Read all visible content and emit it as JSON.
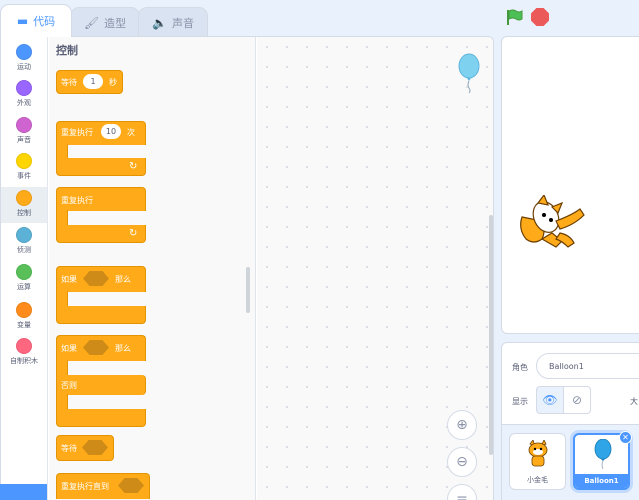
{
  "tabs": [
    {
      "label": "代码",
      "icon": "code-icon",
      "active": true
    },
    {
      "label": "造型",
      "icon": "brush-icon",
      "active": false
    },
    {
      "label": "声音",
      "icon": "speaker-icon",
      "active": false
    }
  ],
  "categories": [
    {
      "label": "运动",
      "color": "#4c97ff"
    },
    {
      "label": "外观",
      "color": "#9966ff"
    },
    {
      "label": "声音",
      "color": "#cf63cf"
    },
    {
      "label": "事件",
      "color": "#ffd500"
    },
    {
      "label": "控制",
      "color": "#ffab19",
      "selected": true
    },
    {
      "label": "侦测",
      "color": "#5cb1d6"
    },
    {
      "label": "运算",
      "color": "#59c059"
    },
    {
      "label": "变量",
      "color": "#ff8c1a"
    },
    {
      "label": "自制积木",
      "color": "#ff6680"
    }
  ],
  "palette": {
    "title": "控制",
    "blocks": {
      "wait_label": "等待",
      "wait_value": "1",
      "wait_unit": "秒",
      "repeat_label": "重复执行",
      "repeat_value": "10",
      "repeat_unit": "次",
      "forever_label": "重复执行",
      "if_label": "如果",
      "then_label": "那么",
      "if_else_if": "如果",
      "if_else_then": "那么",
      "else_label": "否则",
      "wait_until_label": "等待",
      "repeat_until_label": "重复执行直到"
    }
  },
  "sprite_info": {
    "sprite_label": "角色",
    "sprite_name": "Balloon1",
    "show_label": "显示",
    "size_label": "大"
  },
  "sprites": [
    {
      "name": "小金毛",
      "selected": false
    },
    {
      "name": "Balloon1",
      "selected": true
    }
  ],
  "colors": {
    "accent": "#4c97ff",
    "control": "#ffab19",
    "stop": "#ec5959",
    "flag": "#4cbf56"
  }
}
